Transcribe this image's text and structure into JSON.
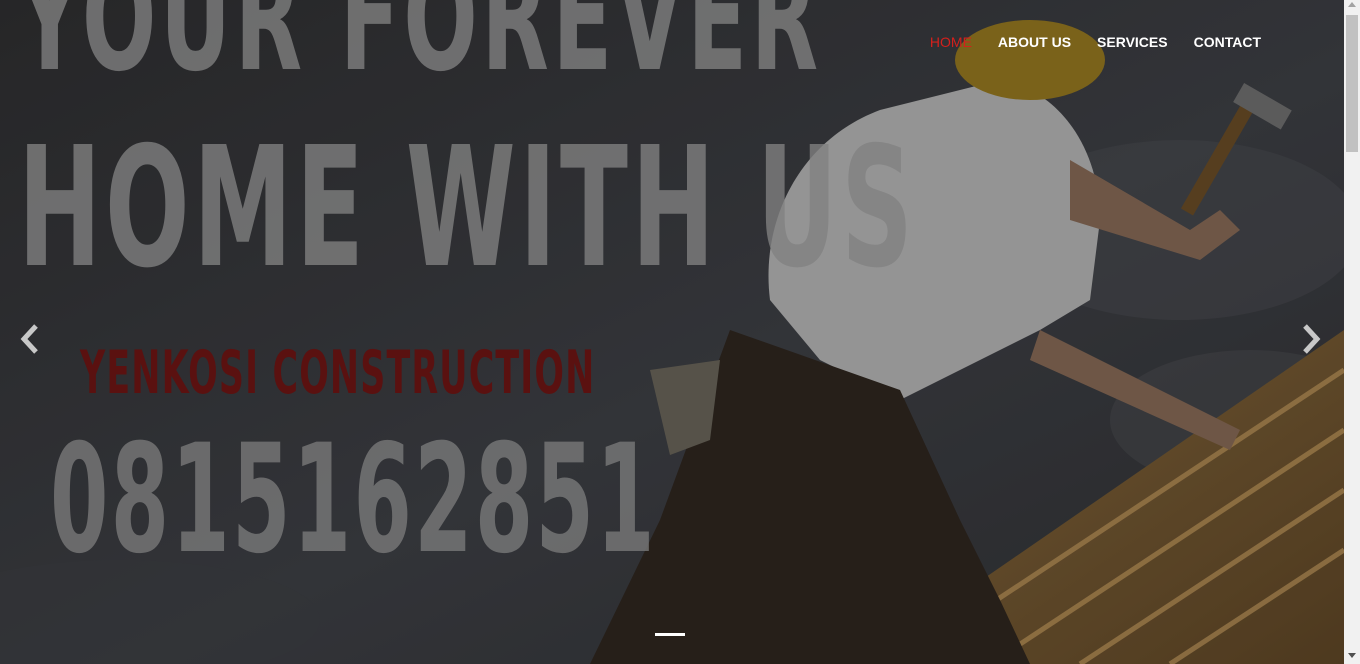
{
  "nav": {
    "items": [
      "HOME",
      "ABOUT US",
      "SERVICES",
      "CONTACT"
    ],
    "active_color": "#d4201c"
  },
  "hero": {
    "headline_line1": "YOUR FOREVER",
    "headline_line2": "HOME WITH US",
    "brand": "YENKOSI CONSTRUCTION",
    "phone": "0815162851",
    "brand_color": "#5a1110"
  },
  "carousel": {
    "prev_icon": "chevron-left-icon",
    "next_icon": "chevron-right-icon",
    "active_slide": 1
  }
}
